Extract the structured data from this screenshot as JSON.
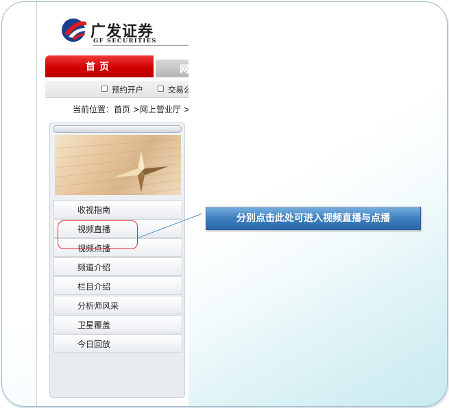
{
  "paragraph_mark": "↵",
  "header": {
    "logo_cn": "广发证券",
    "logo_en": "GF SECURITIES"
  },
  "nav": {
    "home_tab": "首页",
    "next_tab_partial": "网"
  },
  "sub_nav": {
    "items": [
      "预约开户",
      "交易么"
    ]
  },
  "breadcrumb": "当前位置：首页 >网上营业厅 >",
  "menu": {
    "items": [
      "收视指南",
      "视频直播",
      "视频点播",
      "频道介绍",
      "栏目介绍",
      "分析师风采",
      "卫星覆盖",
      "今日回放"
    ]
  },
  "callout": {
    "text": "分别点击此处可进入视频直播与点播"
  },
  "colors": {
    "brand_red": "#cf0000",
    "brand_blue": "#1a3f8c",
    "callout_blue": "#3f7fbf",
    "highlight_red": "#e33030"
  },
  "icons": {
    "logo": "gf-logo-icon",
    "banner": "compass-rose-icon",
    "sub_nav_bullet": "square-bullet-icon"
  }
}
